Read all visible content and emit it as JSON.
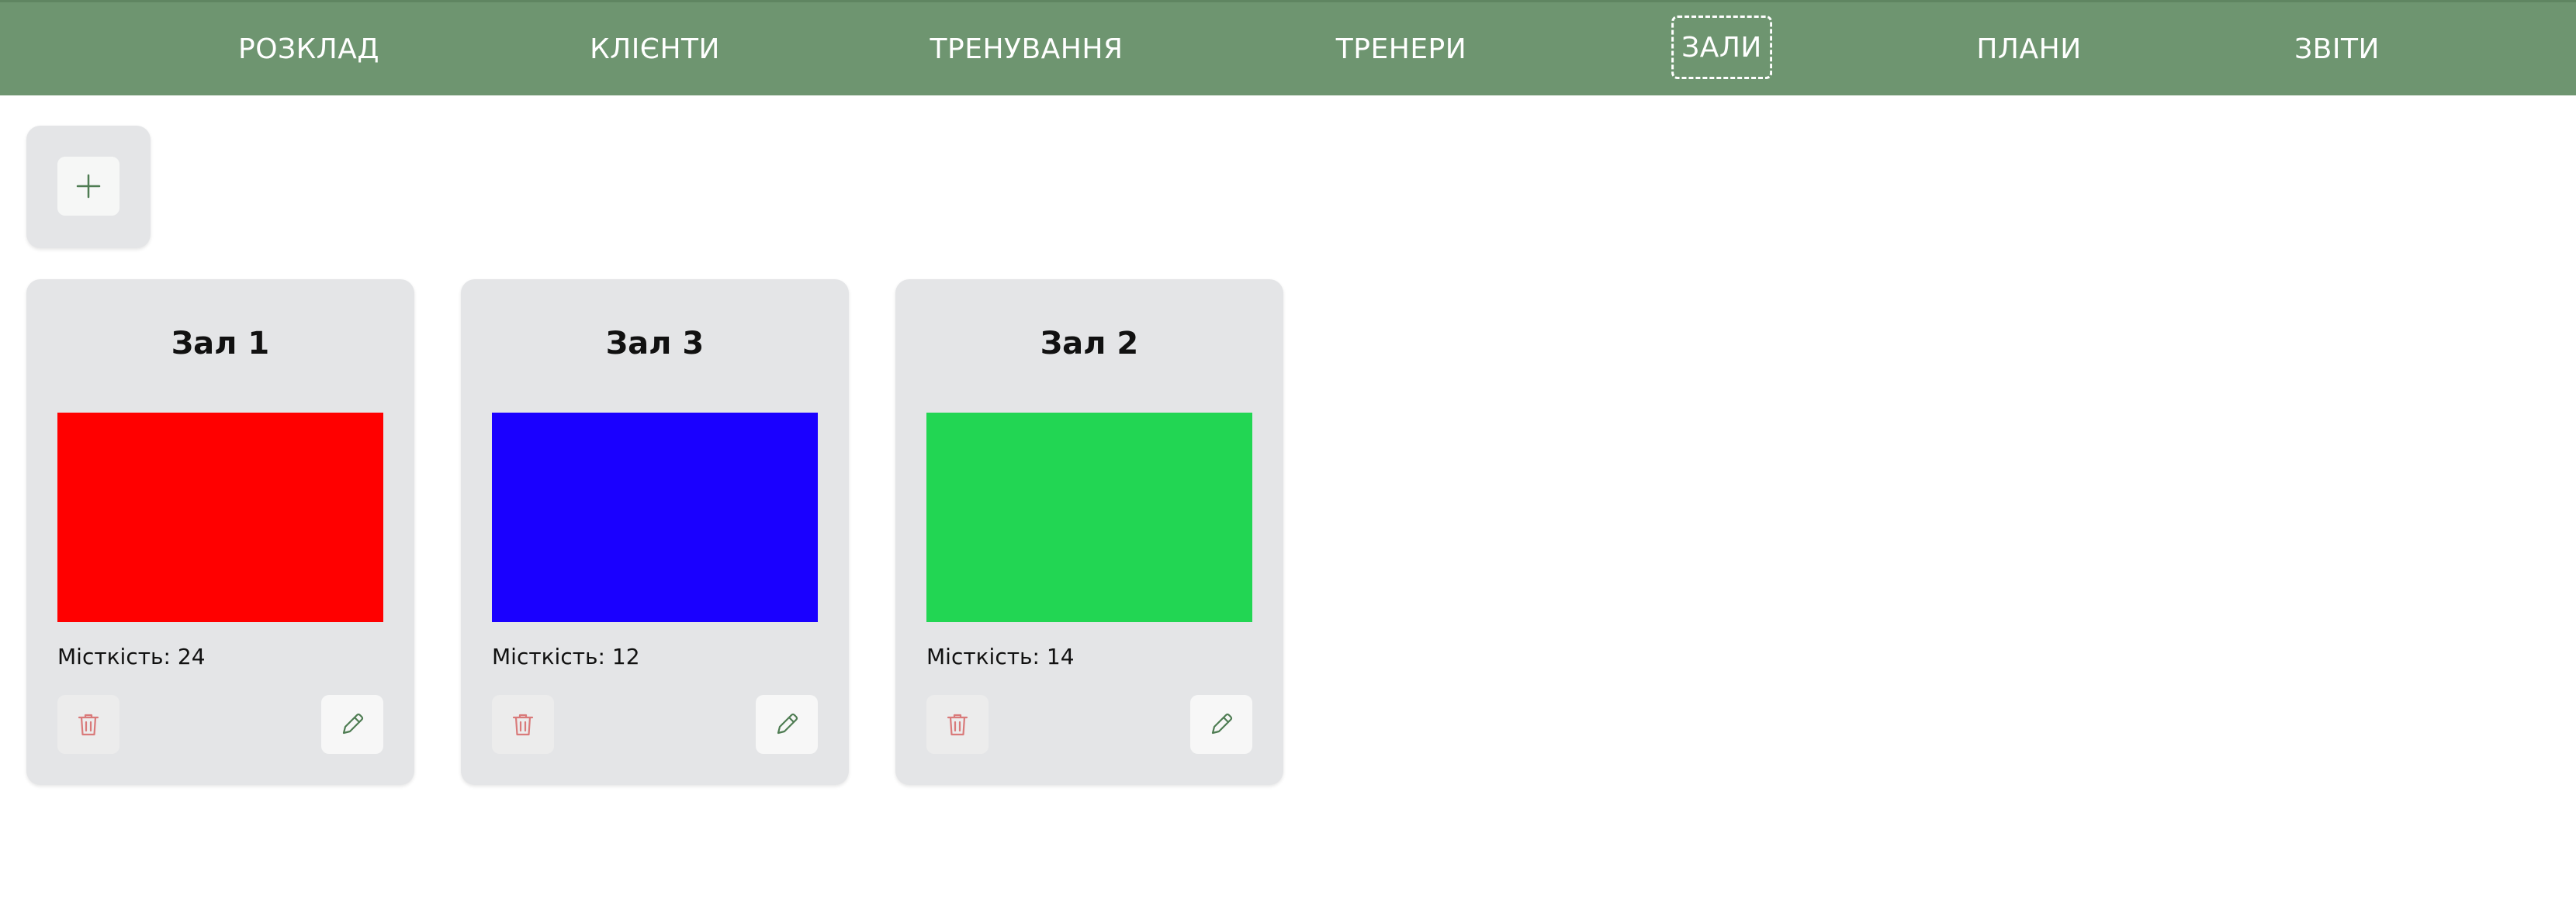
{
  "nav": {
    "items": [
      {
        "label": "РОЗКЛАД"
      },
      {
        "label": "КЛІЄНТИ"
      },
      {
        "label": "ТРЕНУВАННЯ"
      },
      {
        "label": "ТРЕНЕРИ"
      },
      {
        "label": "ЗАЛИ",
        "active": true
      },
      {
        "label": "ПЛАНИ"
      },
      {
        "label": "ЗВІТИ"
      }
    ]
  },
  "add_button": {
    "icon": "plus-icon"
  },
  "halls": [
    {
      "name": "Зал 1",
      "color": "#ff0000",
      "capacity_text": "Місткість: 24"
    },
    {
      "name": "Зал 3",
      "color": "#1a00ff",
      "capacity_text": "Місткість: 12"
    },
    {
      "name": "Зал 2",
      "color": "#22d653",
      "capacity_text": "Місткість: 14"
    }
  ],
  "colors": {
    "nav_bg": "#6e9570",
    "delete_icon": "#d97a7a",
    "edit_icon": "#4e7c52",
    "add_icon": "#4e7c52"
  }
}
